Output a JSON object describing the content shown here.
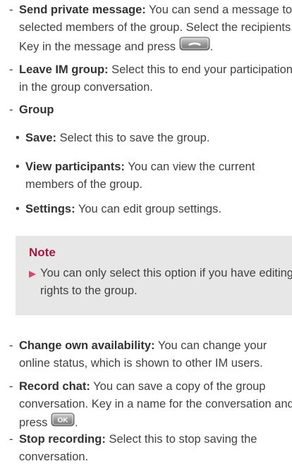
{
  "items": {
    "send_private": {
      "dash": "-",
      "title": "Send private message:",
      "text": "You can send a message to selected members of the group. Select the recipients. Key in the message and press",
      "end": "."
    },
    "leave_im": {
      "dash": "-",
      "title": "Leave IM group:",
      "text": "Select this to end your participation in the group conversation."
    },
    "group": {
      "dash": "-",
      "title": "Group"
    },
    "save": {
      "bullet": "•",
      "title": "Save:",
      "text": "Select this to save the group."
    },
    "view_participants": {
      "bullet": "•",
      "title": "View participants:",
      "text": "You can view the current members of the group."
    },
    "settings": {
      "bullet": "•",
      "title": "Settings:",
      "text": "You can edit group settings."
    },
    "change_availability": {
      "dash": "-",
      "title": "Change own availability:",
      "text": "You can change your online status, which is shown to other IM users."
    },
    "record_chat": {
      "dash": "-",
      "title": "Record chat:",
      "text": "You can save a copy of the group conversation. Key in a name for the conversation and press",
      "end": "."
    },
    "stop_recording": {
      "dash": "-",
      "title": "Stop recording:",
      "text": "Select this to stop saving the conversation."
    }
  },
  "note": {
    "title": "Note",
    "marker": "▶",
    "text": "You can only select this option if you have editing rights to the group."
  },
  "keys": {
    "send_key_icon": "send-key-icon",
    "ok_key_label": "OK"
  },
  "colors": {
    "text": "#414042",
    "note_title": "#a7173d",
    "note_marker": "#d8476c",
    "note_background": "#e7e7e8"
  }
}
